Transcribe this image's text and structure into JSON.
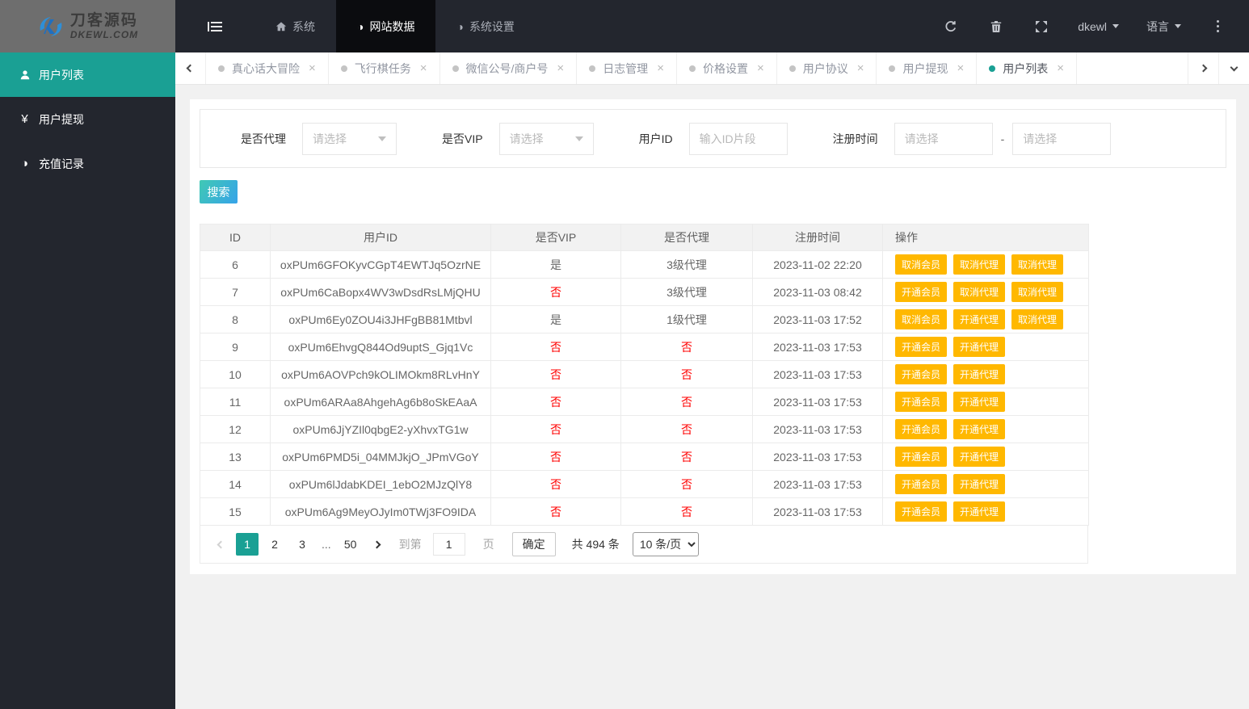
{
  "brand": {
    "title": "刀客源码",
    "subtitle": "DKEWL.COM"
  },
  "topnav": {
    "items": [
      {
        "label": "系统",
        "icon": "home-icon",
        "active": false
      },
      {
        "label": "网站数据",
        "icon": "half-circle-icon",
        "active": true
      },
      {
        "label": "系统设置",
        "icon": "half-circle-icon",
        "active": false
      }
    ],
    "user_label": "dkewl",
    "language_label": "语言"
  },
  "sidebar": {
    "items": [
      {
        "label": "用户列表",
        "icon": "user-icon",
        "active": true
      },
      {
        "label": "用户提现",
        "icon": "yen-icon",
        "active": false
      },
      {
        "label": "充值记录",
        "icon": "half-circle-icon",
        "active": false
      }
    ]
  },
  "tabs": {
    "items": [
      {
        "label": "真心话大冒险",
        "active": false
      },
      {
        "label": "飞行棋任务",
        "active": false
      },
      {
        "label": "微信公号/商户号",
        "active": false
      },
      {
        "label": "日志管理",
        "active": false
      },
      {
        "label": "价格设置",
        "active": false
      },
      {
        "label": "用户协议",
        "active": false
      },
      {
        "label": "用户提现",
        "active": false
      },
      {
        "label": "用户列表",
        "active": true
      }
    ]
  },
  "filters": {
    "agent": {
      "label": "是否代理",
      "placeholder": "请选择"
    },
    "vip": {
      "label": "是否VIP",
      "placeholder": "请选择"
    },
    "user_id": {
      "label": "用户ID",
      "placeholder": "输入ID片段"
    },
    "reg_time": {
      "label": "注册时间",
      "start_placeholder": "请选择",
      "end_placeholder": "请选择",
      "separator": "-"
    },
    "search_label": "搜索"
  },
  "table": {
    "headers": [
      "ID",
      "用户ID",
      "是否VIP",
      "是否代理",
      "注册时间",
      "操作"
    ],
    "rows": [
      {
        "id": "6",
        "user_id": "oxPUm6GFOKyvCGpT4EWTJq5OzrNE",
        "vip": "是",
        "agent": "3级代理",
        "reg_time": "2023-11-02 22:20",
        "actions": [
          "取消会员",
          "取消代理",
          "取消代理"
        ]
      },
      {
        "id": "7",
        "user_id": "oxPUm6CaBopx4WV3wDsdRsLMjQHU",
        "vip": "否",
        "agent": "3级代理",
        "reg_time": "2023-11-03 08:42",
        "actions": [
          "开通会员",
          "取消代理",
          "取消代理"
        ]
      },
      {
        "id": "8",
        "user_id": "oxPUm6Ey0ZOU4i3JHFgBB81Mtbvl",
        "vip": "是",
        "agent": "1级代理",
        "reg_time": "2023-11-03 17:52",
        "actions": [
          "取消会员",
          "开通代理",
          "取消代理"
        ]
      },
      {
        "id": "9",
        "user_id": "oxPUm6EhvgQ844Od9uptS_Gjq1Vc",
        "vip": "否",
        "agent": "否",
        "reg_time": "2023-11-03 17:53",
        "actions": [
          "开通会员",
          "开通代理"
        ]
      },
      {
        "id": "10",
        "user_id": "oxPUm6AOVPch9kOLIMOkm8RLvHnY",
        "vip": "否",
        "agent": "否",
        "reg_time": "2023-11-03 17:53",
        "actions": [
          "开通会员",
          "开通代理"
        ]
      },
      {
        "id": "11",
        "user_id": "oxPUm6ARAa8AhgehAg6b8oSkEAaA",
        "vip": "否",
        "agent": "否",
        "reg_time": "2023-11-03 17:53",
        "actions": [
          "开通会员",
          "开通代理"
        ]
      },
      {
        "id": "12",
        "user_id": "oxPUm6JjYZIl0qbgE2-yXhvxTG1w",
        "vip": "否",
        "agent": "否",
        "reg_time": "2023-11-03 17:53",
        "actions": [
          "开通会员",
          "开通代理"
        ]
      },
      {
        "id": "13",
        "user_id": "oxPUm6PMD5i_04MMJkjO_JPmVGoY",
        "vip": "否",
        "agent": "否",
        "reg_time": "2023-11-03 17:53",
        "actions": [
          "开通会员",
          "开通代理"
        ]
      },
      {
        "id": "14",
        "user_id": "oxPUm6lJdabKDEI_1ebO2MJzQlY8",
        "vip": "否",
        "agent": "否",
        "reg_time": "2023-11-03 17:53",
        "actions": [
          "开通会员",
          "开通代理"
        ]
      },
      {
        "id": "15",
        "user_id": "oxPUm6Ag9MeyOJyIm0TWj3FO9IDA",
        "vip": "否",
        "agent": "否",
        "reg_time": "2023-11-03 17:53",
        "actions": [
          "开通会员",
          "开通代理"
        ]
      }
    ]
  },
  "pagination": {
    "pages": [
      "1",
      "2",
      "3",
      "...",
      "50"
    ],
    "active_page": "1",
    "goto_label": "到第",
    "goto_value": "1",
    "unit_label": "页",
    "confirm_label": "确定",
    "total_label": "共 494 条",
    "page_size_option": "10 条/页"
  },
  "colors": {
    "accent_teal": "#1aa094",
    "topbar_dark": "#23262e",
    "nav_active_dark": "#0b0c0f",
    "action_orange": "#ffb800",
    "negative_red": "#ff0000",
    "search_grad_start": "#40c9b4",
    "search_grad_end": "#36a3e9",
    "logo_gray": "#6e6e6e"
  }
}
